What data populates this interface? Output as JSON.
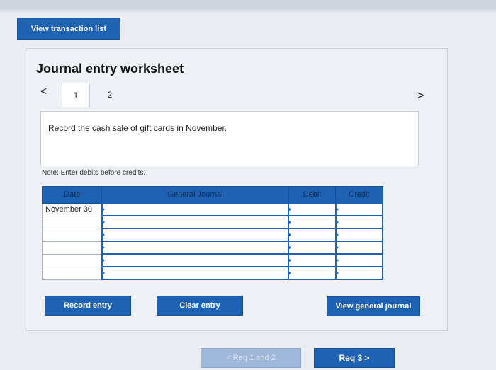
{
  "header": {
    "view_transaction_list": "View transaction list"
  },
  "worksheet": {
    "title": "Journal entry worksheet",
    "prev_glyph": "<",
    "next_glyph": ">",
    "tabs": [
      {
        "label": "1",
        "active": true
      },
      {
        "label": "2",
        "active": false
      }
    ],
    "task": "Record the cash sale of gift cards in November.",
    "note": "Note: Enter debits before credits.",
    "table": {
      "columns": [
        "Date",
        "General Journal",
        "Debit",
        "Credit"
      ],
      "rows": [
        {
          "date": "November 30",
          "account": "",
          "debit": "",
          "credit": ""
        },
        {
          "date": "",
          "account": "",
          "debit": "",
          "credit": ""
        },
        {
          "date": "",
          "account": "",
          "debit": "",
          "credit": ""
        },
        {
          "date": "",
          "account": "",
          "debit": "",
          "credit": ""
        },
        {
          "date": "",
          "account": "",
          "debit": "",
          "credit": ""
        },
        {
          "date": "",
          "account": "",
          "debit": "",
          "credit": ""
        }
      ]
    },
    "buttons": {
      "record_entry": "Record entry",
      "clear_entry": "Clear entry",
      "view_general_journal": "View general journal"
    }
  },
  "footer_nav": {
    "prev_label": "< Req 1 and 2",
    "next_label": "Req 3 >"
  },
  "colors": {
    "accent": "#1f62b3",
    "disabled": "#9fb7d8"
  }
}
